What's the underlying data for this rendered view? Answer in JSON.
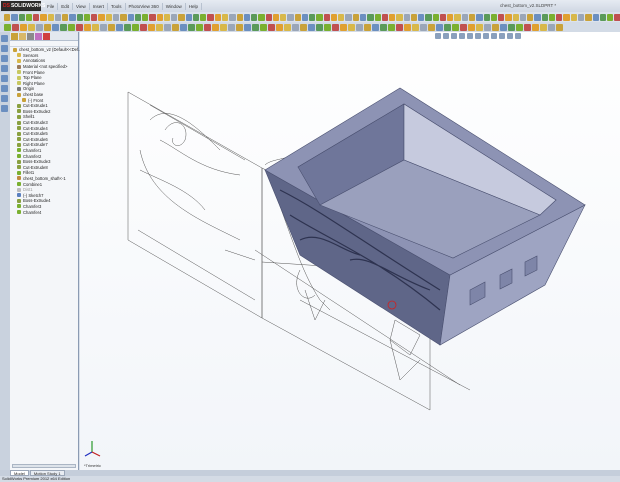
{
  "app": {
    "logo": "SOLIDWORKS",
    "title": "chest_bottom_v2.SLDPRT *"
  },
  "menu": [
    "File",
    "Edit",
    "View",
    "Insert",
    "Tools",
    "PhotoView 360",
    "Window",
    "Help"
  ],
  "tree": {
    "items": [
      {
        "label": "chest_bottom_v2 (Default<<Def...",
        "level": 0,
        "color": "#c9a23a"
      },
      {
        "label": "Sensors",
        "level": 1,
        "color": "#d8b84a"
      },
      {
        "label": "Annotations",
        "level": 1,
        "color": "#d8b84a"
      },
      {
        "label": "Material <not specified>",
        "level": 1,
        "color": "#9a7a5a"
      },
      {
        "label": "Front Plane",
        "level": 1,
        "color": "#c8c860"
      },
      {
        "label": "Top Plane",
        "level": 1,
        "color": "#c8c860"
      },
      {
        "label": "Right Plane",
        "level": 1,
        "color": "#c8c860"
      },
      {
        "label": "Origin",
        "level": 1,
        "color": "#777"
      },
      {
        "label": "chest base",
        "level": 1,
        "color": "#c9a23a"
      },
      {
        "label": "(-) Front",
        "level": 2,
        "color": "#c9a23a"
      },
      {
        "label": "Cut-Extrude1",
        "level": 1,
        "color": "#8aa040"
      },
      {
        "label": "Boss-Extrude2",
        "level": 1,
        "color": "#8aa040"
      },
      {
        "label": "Shell1",
        "level": 1,
        "color": "#8aa040"
      },
      {
        "label": "Cut-Extrude3",
        "level": 1,
        "color": "#8aa040"
      },
      {
        "label": "Cut-Extrude4",
        "level": 1,
        "color": "#8aa040"
      },
      {
        "label": "Cut-Extrude5",
        "level": 1,
        "color": "#8aa040"
      },
      {
        "label": "Cut-Extrude6",
        "level": 1,
        "color": "#8aa040"
      },
      {
        "label": "Cut-Extrude7",
        "level": 1,
        "color": "#8aa040"
      },
      {
        "label": "Chamfer1",
        "level": 1,
        "color": "#7ab030"
      },
      {
        "label": "Chamfer2",
        "level": 1,
        "color": "#7ab030"
      },
      {
        "label": "Boss-Extrude3",
        "level": 1,
        "color": "#8aa040"
      },
      {
        "label": "Cut-Extrude8",
        "level": 1,
        "color": "#8aa040"
      },
      {
        "label": "Fillet1",
        "level": 1,
        "color": "#7ab030"
      },
      {
        "label": "chest_bottom_shaft<-1",
        "level": 1,
        "color": "#c08a40"
      },
      {
        "label": "Combine1",
        "level": 1,
        "color": "#7ab030"
      },
      {
        "label": "Dist1",
        "level": 1,
        "color": "#bbb",
        "suppressed": true
      },
      {
        "label": "(-) Sketch7",
        "level": 1,
        "color": "#5a80c0"
      },
      {
        "label": "Boss-Extrude4",
        "level": 1,
        "color": "#8aa040"
      },
      {
        "label": "Chamfer3",
        "level": 1,
        "color": "#7ab030"
      },
      {
        "label": "Chamfer4",
        "level": 1,
        "color": "#7ab030"
      }
    ]
  },
  "view": {
    "orientation": "*Trimetric",
    "model_color": "#7e85a8"
  },
  "tabs": [
    {
      "label": "Model",
      "active": true
    },
    {
      "label": "Motion Study 1",
      "active": false
    }
  ],
  "status": "SolidWorks Premium 2012 x64 Edition"
}
